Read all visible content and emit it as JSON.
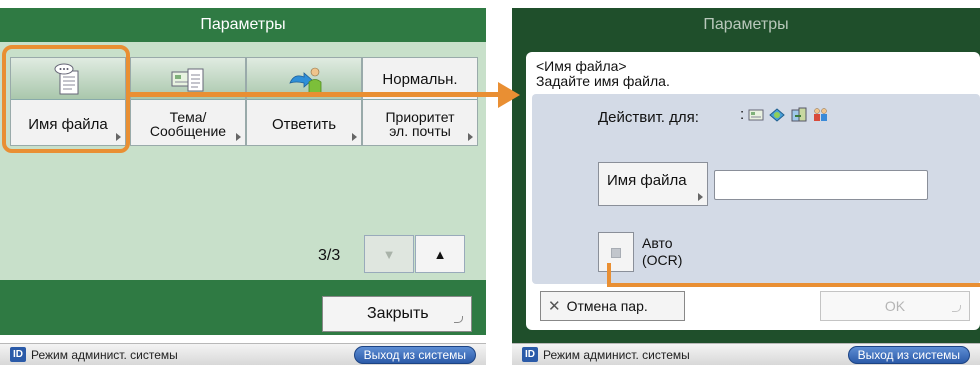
{
  "left": {
    "title": "Параметры",
    "tiles": [
      {
        "label": "Имя файла",
        "icon": "filename-document-icon"
      },
      {
        "label_line1": "Тема/",
        "label_line2": "Сообщение",
        "icon": "subject-message-icon"
      },
      {
        "label": "Ответить",
        "icon": "reply-arrow-person-icon"
      },
      {
        "top_label": "Нормальн.",
        "label_line1": "Приоритет",
        "label_line2": "эл. почты"
      }
    ],
    "page_indicator": "3/3",
    "page_down_glyph": "▼",
    "page_up_glyph": "▲",
    "close_label": "Закрыть"
  },
  "right": {
    "title": "Параметры",
    "dialog_heading1": "<Имя файла>",
    "dialog_heading2": "Задайте имя файла.",
    "valid_for_label": "Действит. для:",
    "valid_for_sep": ":",
    "filename_button_label": "Имя файла",
    "filename_value": "",
    "auto_label1": "Авто",
    "auto_label2": "(OCR)",
    "cancel_label": "Отмена пар.",
    "cancel_glyph": "✕",
    "ok_label": "OK"
  },
  "statusbar": {
    "id_badge": "ID",
    "mode_text": "Режим админист. системы",
    "logout_label": "Выход из системы"
  },
  "colors": {
    "green_header": "#2f7a43",
    "green_body": "#c8e0ca",
    "dark_green": "#1f4f2b",
    "highlight_orange": "#e98f33",
    "dialog_inner": "#d3dae6",
    "logout_blue": "#2b5aa8"
  }
}
